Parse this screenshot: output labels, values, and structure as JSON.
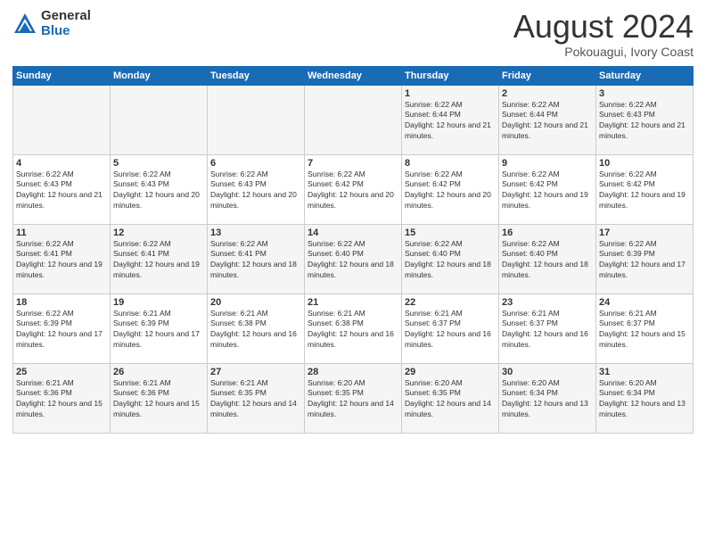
{
  "header": {
    "logo_general": "General",
    "logo_blue": "Blue",
    "month_title": "August 2024",
    "subtitle": "Pokouagui, Ivory Coast"
  },
  "days_of_week": [
    "Sunday",
    "Monday",
    "Tuesday",
    "Wednesday",
    "Thursday",
    "Friday",
    "Saturday"
  ],
  "weeks": [
    [
      {
        "day": "",
        "info": ""
      },
      {
        "day": "",
        "info": ""
      },
      {
        "day": "",
        "info": ""
      },
      {
        "day": "",
        "info": ""
      },
      {
        "day": "1",
        "info": "Sunrise: 6:22 AM\nSunset: 6:44 PM\nDaylight: 12 hours and 21 minutes."
      },
      {
        "day": "2",
        "info": "Sunrise: 6:22 AM\nSunset: 6:44 PM\nDaylight: 12 hours and 21 minutes."
      },
      {
        "day": "3",
        "info": "Sunrise: 6:22 AM\nSunset: 6:43 PM\nDaylight: 12 hours and 21 minutes."
      }
    ],
    [
      {
        "day": "4",
        "info": "Sunrise: 6:22 AM\nSunset: 6:43 PM\nDaylight: 12 hours and 21 minutes."
      },
      {
        "day": "5",
        "info": "Sunrise: 6:22 AM\nSunset: 6:43 PM\nDaylight: 12 hours and 20 minutes."
      },
      {
        "day": "6",
        "info": "Sunrise: 6:22 AM\nSunset: 6:43 PM\nDaylight: 12 hours and 20 minutes."
      },
      {
        "day": "7",
        "info": "Sunrise: 6:22 AM\nSunset: 6:42 PM\nDaylight: 12 hours and 20 minutes."
      },
      {
        "day": "8",
        "info": "Sunrise: 6:22 AM\nSunset: 6:42 PM\nDaylight: 12 hours and 20 minutes."
      },
      {
        "day": "9",
        "info": "Sunrise: 6:22 AM\nSunset: 6:42 PM\nDaylight: 12 hours and 19 minutes."
      },
      {
        "day": "10",
        "info": "Sunrise: 6:22 AM\nSunset: 6:42 PM\nDaylight: 12 hours and 19 minutes."
      }
    ],
    [
      {
        "day": "11",
        "info": "Sunrise: 6:22 AM\nSunset: 6:41 PM\nDaylight: 12 hours and 19 minutes."
      },
      {
        "day": "12",
        "info": "Sunrise: 6:22 AM\nSunset: 6:41 PM\nDaylight: 12 hours and 19 minutes."
      },
      {
        "day": "13",
        "info": "Sunrise: 6:22 AM\nSunset: 6:41 PM\nDaylight: 12 hours and 18 minutes."
      },
      {
        "day": "14",
        "info": "Sunrise: 6:22 AM\nSunset: 6:40 PM\nDaylight: 12 hours and 18 minutes."
      },
      {
        "day": "15",
        "info": "Sunrise: 6:22 AM\nSunset: 6:40 PM\nDaylight: 12 hours and 18 minutes."
      },
      {
        "day": "16",
        "info": "Sunrise: 6:22 AM\nSunset: 6:40 PM\nDaylight: 12 hours and 18 minutes."
      },
      {
        "day": "17",
        "info": "Sunrise: 6:22 AM\nSunset: 6:39 PM\nDaylight: 12 hours and 17 minutes."
      }
    ],
    [
      {
        "day": "18",
        "info": "Sunrise: 6:22 AM\nSunset: 6:39 PM\nDaylight: 12 hours and 17 minutes."
      },
      {
        "day": "19",
        "info": "Sunrise: 6:21 AM\nSunset: 6:39 PM\nDaylight: 12 hours and 17 minutes."
      },
      {
        "day": "20",
        "info": "Sunrise: 6:21 AM\nSunset: 6:38 PM\nDaylight: 12 hours and 16 minutes."
      },
      {
        "day": "21",
        "info": "Sunrise: 6:21 AM\nSunset: 6:38 PM\nDaylight: 12 hours and 16 minutes."
      },
      {
        "day": "22",
        "info": "Sunrise: 6:21 AM\nSunset: 6:37 PM\nDaylight: 12 hours and 16 minutes."
      },
      {
        "day": "23",
        "info": "Sunrise: 6:21 AM\nSunset: 6:37 PM\nDaylight: 12 hours and 16 minutes."
      },
      {
        "day": "24",
        "info": "Sunrise: 6:21 AM\nSunset: 6:37 PM\nDaylight: 12 hours and 15 minutes."
      }
    ],
    [
      {
        "day": "25",
        "info": "Sunrise: 6:21 AM\nSunset: 6:36 PM\nDaylight: 12 hours and 15 minutes."
      },
      {
        "day": "26",
        "info": "Sunrise: 6:21 AM\nSunset: 6:36 PM\nDaylight: 12 hours and 15 minutes."
      },
      {
        "day": "27",
        "info": "Sunrise: 6:21 AM\nSunset: 6:35 PM\nDaylight: 12 hours and 14 minutes."
      },
      {
        "day": "28",
        "info": "Sunrise: 6:20 AM\nSunset: 6:35 PM\nDaylight: 12 hours and 14 minutes."
      },
      {
        "day": "29",
        "info": "Sunrise: 6:20 AM\nSunset: 6:35 PM\nDaylight: 12 hours and 14 minutes."
      },
      {
        "day": "30",
        "info": "Sunrise: 6:20 AM\nSunset: 6:34 PM\nDaylight: 12 hours and 13 minutes."
      },
      {
        "day": "31",
        "info": "Sunrise: 6:20 AM\nSunset: 6:34 PM\nDaylight: 12 hours and 13 minutes."
      }
    ]
  ]
}
